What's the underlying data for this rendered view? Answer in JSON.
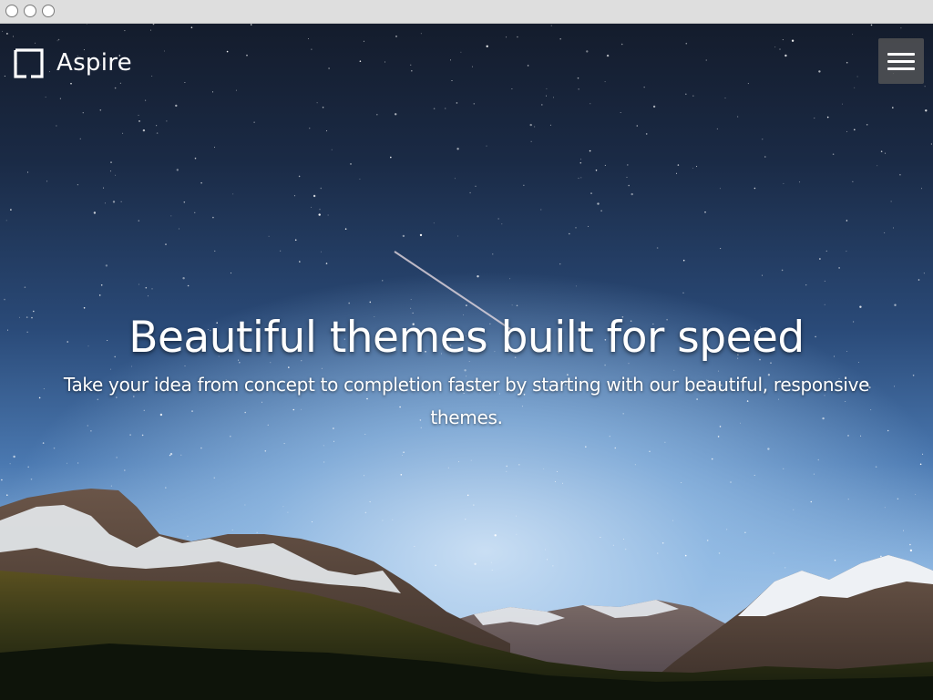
{
  "navbar": {
    "brand_text": "Aspire",
    "brand_icon": "square-bracket-logo-icon",
    "menu_icon": "hamburger-menu-icon"
  },
  "hero": {
    "title": "Beautiful themes built for speed",
    "subtitle": "Take your idea from concept to completion faster by starting with our beautiful, responsive themes."
  },
  "colors": {
    "text": "#ffffff",
    "toggle_bg": "#5a5a5a",
    "sky_top": "#141c2c",
    "sky_horizon": "#b4d0ee",
    "titlebar": "#dedede"
  }
}
